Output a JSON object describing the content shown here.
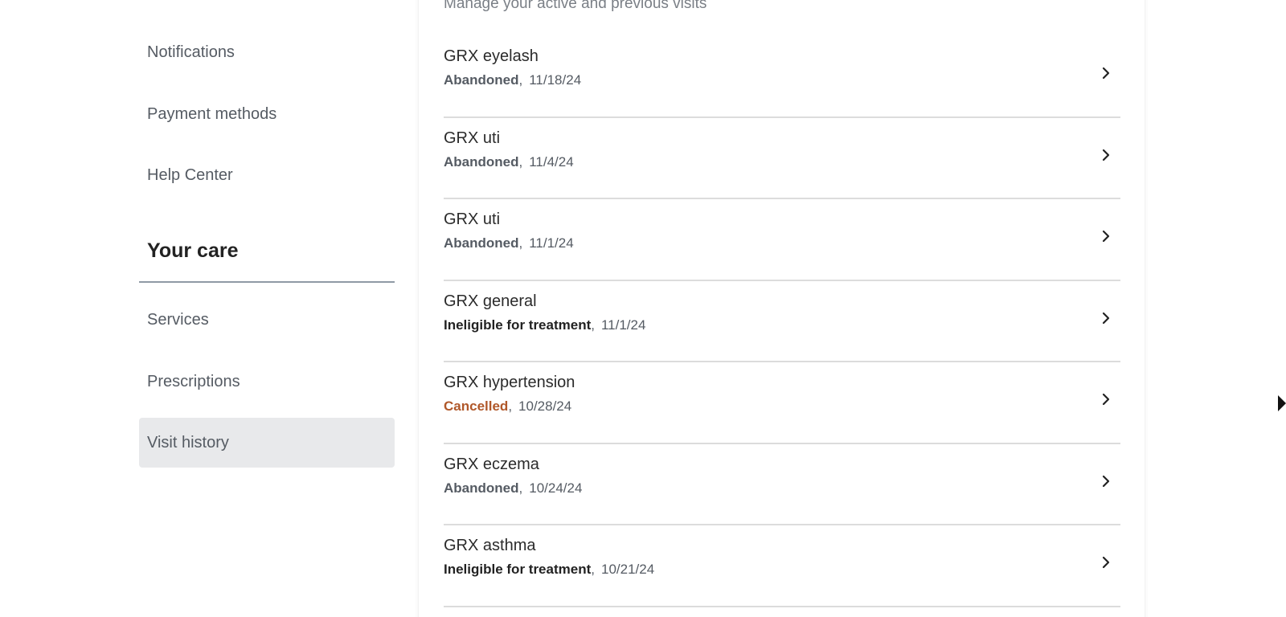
{
  "sidebar": {
    "account_items": [
      {
        "label": "Notifications"
      },
      {
        "label": "Payment methods"
      },
      {
        "label": "Help Center"
      }
    ],
    "section_title": "Your care",
    "care_items": [
      {
        "label": "Services"
      },
      {
        "label": "Prescriptions"
      },
      {
        "label": "Visit history",
        "active": true
      }
    ]
  },
  "main": {
    "subtitle": "Manage your active and previous visits",
    "visits": [
      {
        "title": "GRX eyelash",
        "status": "Abandoned",
        "date": "11/18/24"
      },
      {
        "title": "GRX uti",
        "status": "Abandoned",
        "date": "11/4/24"
      },
      {
        "title": "GRX uti",
        "status": "Abandoned",
        "date": "11/1/24"
      },
      {
        "title": "GRX general",
        "status": "Ineligible for treatment",
        "date": "11/1/24"
      },
      {
        "title": "GRX hypertension",
        "status": "Cancelled",
        "date": "10/28/24"
      },
      {
        "title": "GRX eczema",
        "status": "Abandoned",
        "date": "10/24/24"
      },
      {
        "title": "GRX asthma",
        "status": "Ineligible for treatment",
        "date": "10/21/24"
      }
    ]
  },
  "colors": {
    "active_nav_bg": "#e8e9eb",
    "cancelled_status": "#b0582a",
    "divider": "#dcdcdc"
  },
  "icons": {
    "row_arrow": "chevron-right-icon"
  }
}
